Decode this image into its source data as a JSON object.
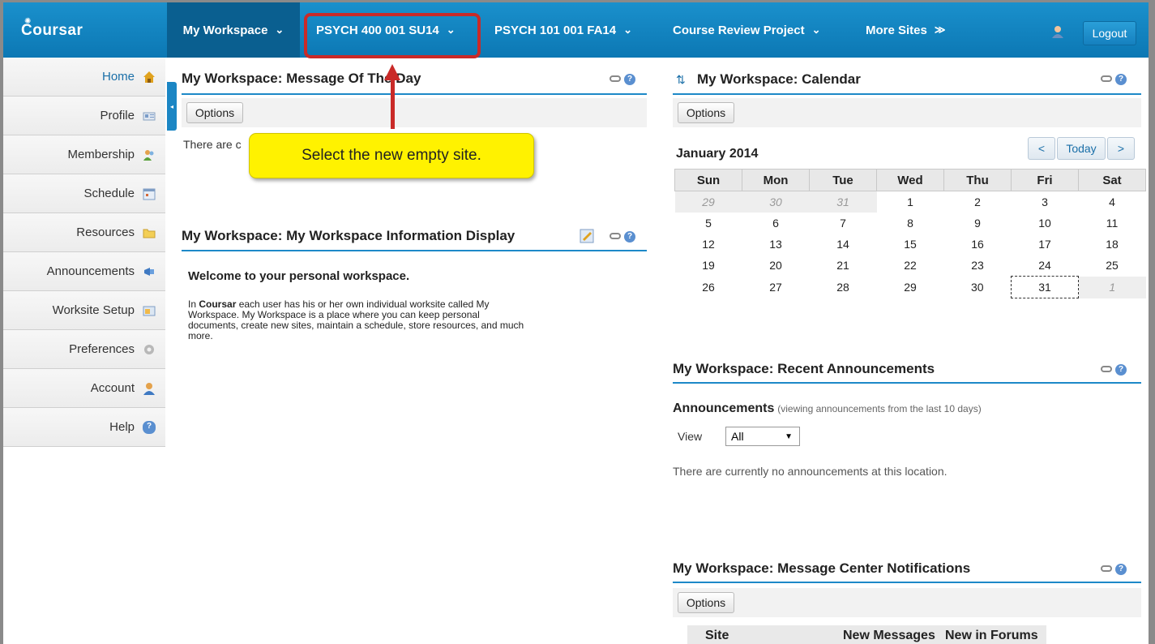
{
  "topbar": {
    "logo": "Coursar",
    "tabs": [
      {
        "label": "My Workspace"
      },
      {
        "label": "PSYCH 400 001 SU14"
      },
      {
        "label": "PSYCH 101 001 FA14"
      },
      {
        "label": "Course Review Project"
      },
      {
        "label": "More Sites"
      }
    ],
    "logout": "Logout"
  },
  "sidebar": {
    "items": [
      {
        "label": "Home",
        "icon": "home-icon"
      },
      {
        "label": "Profile",
        "icon": "profile-icon"
      },
      {
        "label": "Membership",
        "icon": "membership-icon"
      },
      {
        "label": "Schedule",
        "icon": "schedule-icon"
      },
      {
        "label": "Resources",
        "icon": "folder-icon"
      },
      {
        "label": "Announcements",
        "icon": "megaphone-icon"
      },
      {
        "label": "Worksite Setup",
        "icon": "worksite-icon"
      },
      {
        "label": "Preferences",
        "icon": "gear-icon"
      },
      {
        "label": "Account",
        "icon": "account-icon"
      },
      {
        "label": "Help",
        "icon": "help-icon"
      }
    ]
  },
  "motd": {
    "title": "My Workspace: Message Of The Day",
    "options": "Options",
    "body": "There are c"
  },
  "info": {
    "title": "My Workspace: My Workspace Information Display",
    "welcome": "Welcome to your personal workspace.",
    "body_lead": "Coursar",
    "body_line1_pre": "In ",
    "body_line1_post": " each user has his or her own individual worksite called My",
    "body_line2": "Workspace. My Workspace is a place where you can keep personal",
    "body_line3": "documents, create new sites, maintain a schedule, store resources, and much",
    "body_line4": "more."
  },
  "callout": {
    "text": "Select the new empty site."
  },
  "calendar": {
    "title": "My Workspace: Calendar",
    "options": "Options",
    "month": "January 2014",
    "prev": "<",
    "today": "Today",
    "next": ">",
    "days": [
      "Sun",
      "Mon",
      "Tue",
      "Wed",
      "Thu",
      "Fri",
      "Sat"
    ],
    "weeks": [
      [
        "29",
        "30",
        "31",
        "1",
        "2",
        "3",
        "4"
      ],
      [
        "5",
        "6",
        "7",
        "8",
        "9",
        "10",
        "11"
      ],
      [
        "12",
        "13",
        "14",
        "15",
        "16",
        "17",
        "18"
      ],
      [
        "19",
        "20",
        "21",
        "22",
        "23",
        "24",
        "25"
      ],
      [
        "26",
        "27",
        "28",
        "29",
        "30",
        "31",
        "1"
      ]
    ]
  },
  "announcements": {
    "title": "My Workspace: Recent Announcements",
    "heading": "Announcements",
    "subheading": "(viewing announcements from the last 10 days)",
    "view_label": "View",
    "view_value": "All",
    "empty": "There are currently no announcements at this location."
  },
  "messages": {
    "title": "My Workspace: Message Center Notifications",
    "options": "Options",
    "columns": [
      "Site",
      "New Messages",
      "New in Forums"
    ]
  },
  "colors": {
    "accent": "#1a90cc",
    "highlight": "#c92a28",
    "callout": "#fff200"
  }
}
